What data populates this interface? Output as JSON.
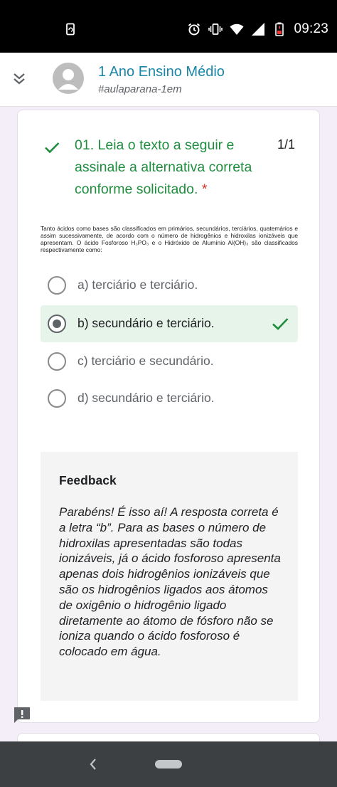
{
  "status_bar": {
    "time": "09:23",
    "icons": [
      "screenshot-rotate-icon",
      "alarm-icon",
      "vibrate-icon",
      "wifi-icon",
      "signal-icon",
      "battery-low-icon"
    ]
  },
  "header": {
    "title": "1 Ano Ensino Médio",
    "subtitle": "#aulaparana-1em",
    "icons": [
      "collapse-chevrons-icon",
      "avatar-person-icon"
    ]
  },
  "question": {
    "title": "01. Leia o texto a seguir e assinale a alternativa correta conforme solicitado.",
    "required_mark": "*",
    "score": "1/1",
    "text": "Tanto ácidos como bases são classificados em primários, secundários, terciários, quatemários e assim sucessivamente, de acordo com o número de hidrogênios e hidroxilas ionizáveis que apresentam.  O ácido Fosforoso H₃PO₃ e o Hidróxido de Alumínio Al(OH)₃ são classificados respectivamente como:",
    "options": [
      {
        "label": "a) terciário e terciário."
      },
      {
        "label": "b) secundário e terciário."
      },
      {
        "label": "c) terciário e secundário."
      },
      {
        "label": "d) secundário e terciário."
      }
    ],
    "selected_index": 1,
    "correct_color": "#1e8e3e"
  },
  "feedback": {
    "title": "Feedback",
    "text": "Parabéns! É isso aí! A resposta correta é a letra “b”. Para as bases o número de hidroxilas apresentadas são todas ionizáveis, já o ácido fosforoso apresenta apenas dois hidrogênios ionizáveis que são os hidrogênios ligados aos átomos de oxigênio o hidrogênio ligado diretamente ao átomo de fósforo não se ioniza quando o ácido fosforoso é colocado em água."
  },
  "colors": {
    "accent_title": "#1a86a8",
    "selected_bg": "#e6f4ea",
    "page_bg": "#f3eef7",
    "nav_bar": "#3c4043"
  }
}
